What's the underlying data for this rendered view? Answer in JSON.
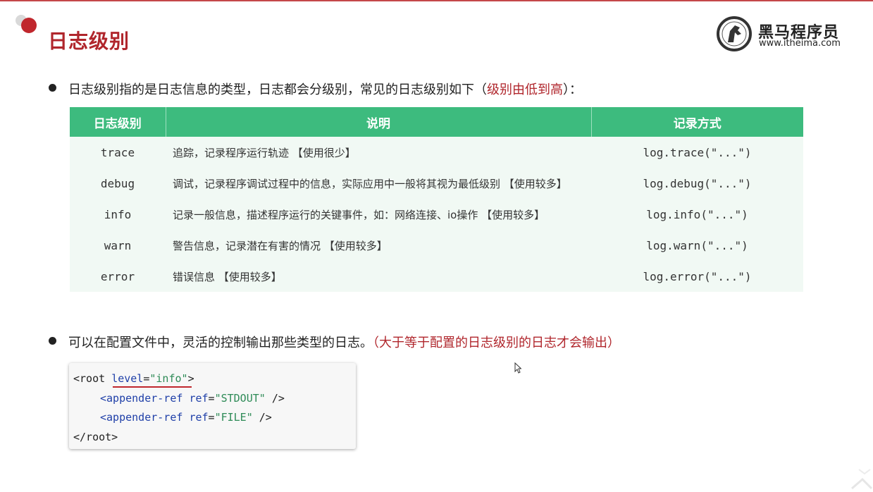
{
  "header": {
    "title": "日志级别"
  },
  "logo": {
    "name": "黑马程序员",
    "url": "www.itheima.com"
  },
  "bullet1": {
    "text": "日志级别指的是日志信息的类型，日志都会分级别，常见的日志级别如下（",
    "highlight": "级别由低到高",
    "suffix": "）："
  },
  "table": {
    "headers": [
      "日志级别",
      "说明",
      "记录方式"
    ],
    "rows": [
      {
        "level": "trace",
        "desc": "追踪，记录程序运行轨迹 【使用很少】",
        "call": "log.trace(\"...\")"
      },
      {
        "level": "debug",
        "desc": "调试，记录程序调试过程中的信息，实际应用中一般将其视为最低级别 【使用较多】",
        "call": "log.debug(\"...\")"
      },
      {
        "level": "info",
        "desc": "记录一般信息，描述程序运行的关键事件，如：网络连接、io操作 【使用较多】",
        "call": "log.info(\"...\")"
      },
      {
        "level": "warn",
        "desc": "警告信息，记录潜在有害的情况 【使用较多】",
        "call": "log.warn(\"...\")"
      },
      {
        "level": "error",
        "desc": "错误信息 【使用较多】",
        "call": "log.error(\"...\")"
      }
    ]
  },
  "bullet2": {
    "text": "可以在配置文件中，灵活的控制输出那些类型的日志。",
    "highlight": "（大于等于配置的日志级别的日志才会输出）"
  },
  "code": {
    "line1_open": "<root ",
    "line1_attr": "level",
    "line1_eq": "=",
    "line1_val": "\"info\"",
    "line1_close": ">",
    "line2_tag": "<appender-ref",
    "line2_attr": "ref",
    "line2_val": "\"STDOUT\"",
    "line2_end": " />",
    "line3_tag": "<appender-ref",
    "line3_attr": "ref",
    "line3_val": "\"FILE\"",
    "line3_end": " />",
    "line4": "</root>"
  },
  "colors": {
    "accent_red": "#b0262c",
    "table_header_green": "#3dbb7e",
    "table_row_bg": "#f1f9f4"
  }
}
